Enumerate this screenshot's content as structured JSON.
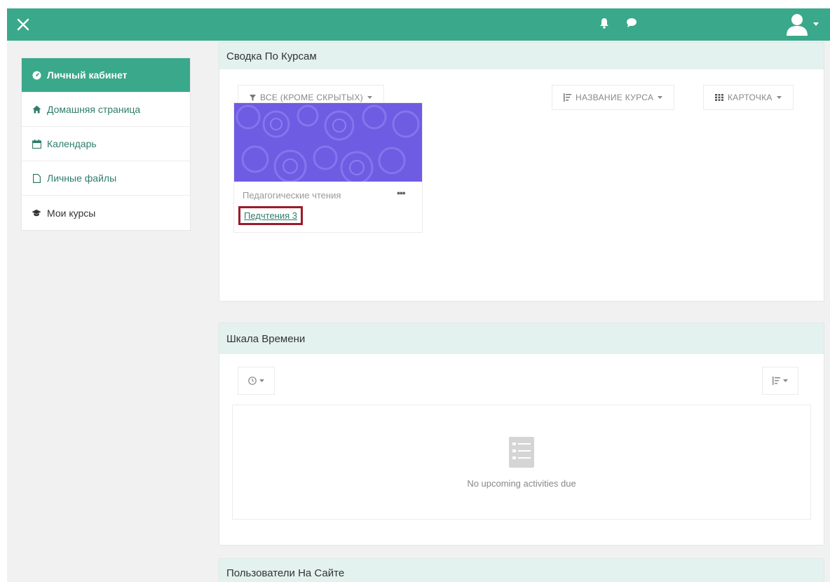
{
  "topbar": {
    "close_icon": "close-icon",
    "notification_icon": "bell-icon",
    "messages_icon": "chat-icon",
    "user_icon": "user-icon",
    "brand_color": "#3aa88a"
  },
  "sidebar": {
    "items": [
      {
        "label": "Личный кабинет",
        "icon": "dashboard-icon",
        "active": true
      },
      {
        "label": "Домашняя страница",
        "icon": "home-icon"
      },
      {
        "label": "Календарь",
        "icon": "calendar-icon"
      },
      {
        "label": "Личные файлы",
        "icon": "file-icon"
      },
      {
        "label": "Мои курсы",
        "icon": "graduation-cap-icon"
      }
    ]
  },
  "course_overview": {
    "title": "Сводка По Курсам",
    "filter_label": "ВСЕ (КРОМЕ СКРЫТЫХ)",
    "sort_label": "НАЗВАНИЕ КУРСА",
    "view_label": "КАРТОЧКА",
    "course": {
      "category": "Педагогические чтения",
      "name": "Педчтения 3",
      "menu": "•••"
    }
  },
  "timeline": {
    "title": "Шкала Времени",
    "empty_message": "No upcoming activities due"
  },
  "online_users": {
    "title": "Пользователи На Сайте"
  }
}
